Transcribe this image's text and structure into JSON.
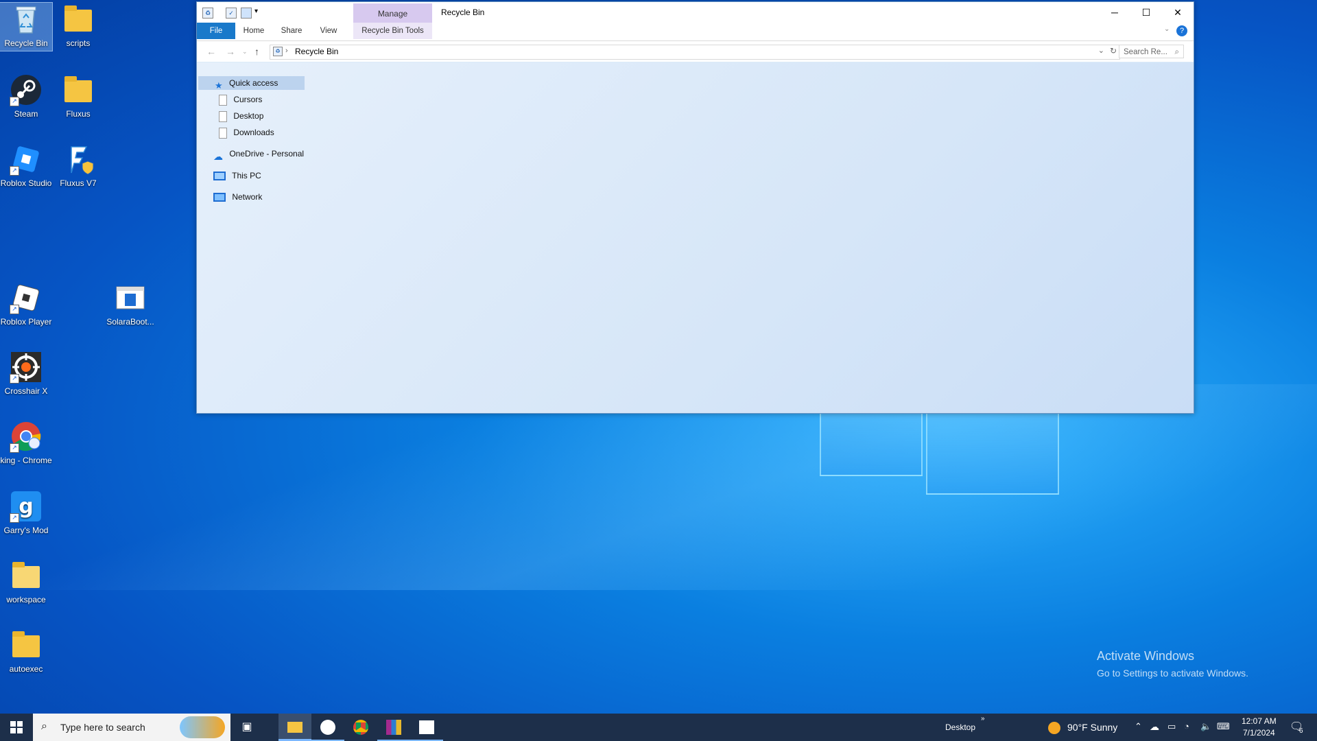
{
  "desktop": {
    "icons": [
      {
        "label": "Recycle Bin",
        "icon": "recycle-bin-icon"
      },
      {
        "label": "scripts",
        "icon": "folder-icon"
      },
      {
        "label": "Steam",
        "icon": "steam-icon"
      },
      {
        "label": "Fluxus",
        "icon": "folder-icon"
      },
      {
        "label": "Roblox Studio",
        "icon": "roblox-studio-icon"
      },
      {
        "label": "Fluxus V7",
        "icon": "fluxus-icon"
      },
      {
        "label": "Roblox Player",
        "icon": "roblox-player-icon"
      },
      {
        "label": "SolaraBoot...",
        "icon": "solara-icon"
      },
      {
        "label": "Crosshair X",
        "icon": "crosshair-icon"
      },
      {
        "label": "king - Chrome",
        "icon": "chrome-icon"
      },
      {
        "label": "Garry's Mod",
        "icon": "garrys-mod-icon"
      },
      {
        "label": "workspace",
        "icon": "folder-icon"
      },
      {
        "label": "autoexec",
        "icon": "folder-icon"
      }
    ],
    "watermark": {
      "title": "Activate Windows",
      "subtitle": "Go to Settings to activate Windows."
    }
  },
  "explorer": {
    "title": "Recycle Bin",
    "manage_tab": "Manage",
    "ribbon_tabs": [
      "File",
      "Home",
      "Share",
      "View",
      "Recycle Bin Tools"
    ],
    "address": {
      "path": "Recycle Bin"
    },
    "search_placeholder": "Search Re...",
    "nav": {
      "quick_access": "Quick access",
      "items": [
        "Cursors",
        "Desktop",
        "Downloads"
      ],
      "onedrive": "OneDrive - Personal",
      "this_pc": "This PC",
      "network": "Network"
    }
  },
  "taskbar": {
    "search_placeholder": "Type here to search",
    "desktop_label": "Desktop",
    "weather": "90°F  Sunny",
    "time": "12:07 AM",
    "date": "7/1/2024",
    "notification_count": "6"
  },
  "colors": {
    "ribbon_file": "#1979ca",
    "manage_tab": "#d7c9ef",
    "taskbar": "#1d2f4a"
  }
}
